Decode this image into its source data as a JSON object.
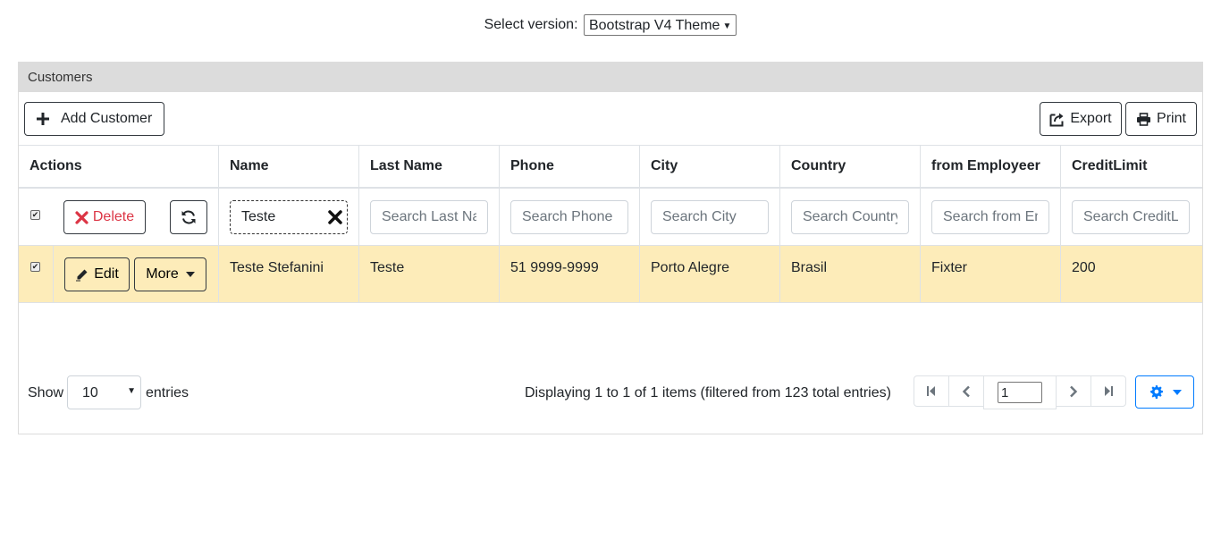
{
  "version_selector": {
    "label": "Select version:",
    "selected": "Bootstrap V4 Theme"
  },
  "card": {
    "title": "Customers"
  },
  "toolbar": {
    "add_label": "Add Customer",
    "export_label": "Export",
    "print_label": "Print"
  },
  "columns": [
    "Actions",
    "Name",
    "Last Name",
    "Phone",
    "City",
    "Country",
    "from Employeer",
    "CreditLimit"
  ],
  "filters": {
    "delete_label": "Delete",
    "name_value": "Teste",
    "placeholders": {
      "last_name": "Search Last Name",
      "phone": "Search Phone",
      "city": "Search City",
      "country": "Search Country",
      "employer": "Search from Employeer",
      "credit": "Search CreditLimit"
    }
  },
  "row_actions": {
    "edit_label": "Edit",
    "more_label": "More"
  },
  "rows": [
    {
      "name": "Teste Stefanini",
      "last_name": "Teste",
      "phone": "51 9999-9999",
      "city": "Porto Alegre",
      "country": "Brasil",
      "employer": "Fixter",
      "credit": "200"
    }
  ],
  "footer": {
    "show_label": "Show",
    "page_size": "10",
    "entries_label": "entries",
    "display_info": "Displaying 1 to 1 of 1 items (filtered from 123 total entries)",
    "current_page": "1"
  },
  "colors": {
    "row_highlight": "#fdecb9",
    "delete_red": "#dc3545",
    "primary_blue": "#007bff"
  }
}
